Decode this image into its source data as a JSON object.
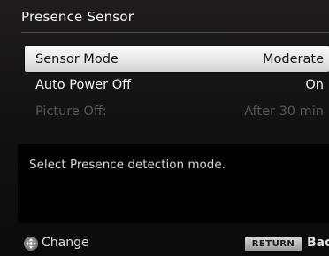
{
  "screen": {
    "title": "Presence Sensor"
  },
  "menu": {
    "items": [
      {
        "label": "Sensor Mode",
        "value": "Moderate",
        "state": "selected"
      },
      {
        "label": "Auto Power Off",
        "value": "On",
        "state": "normal"
      },
      {
        "label": "Picture Off:",
        "value": "After 30 min",
        "state": "disabled"
      }
    ]
  },
  "help": {
    "text": "Select Presence detection mode."
  },
  "footer": {
    "navigate_icon": "joystick-icon",
    "change_label": "Change",
    "return_key_label": "RETURN",
    "back_label": "Back"
  },
  "colors": {
    "selection_highlight": "#eeeeee",
    "disabled_text": "#585656",
    "help_background": "#000000"
  }
}
